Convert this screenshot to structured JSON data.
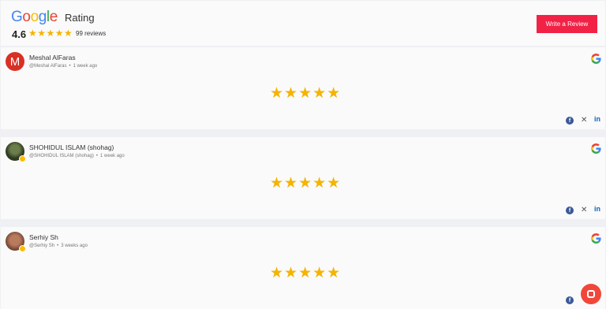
{
  "header": {
    "logo_letters": [
      "G",
      "o",
      "o",
      "g",
      "l",
      "e"
    ],
    "rating_title": "Rating",
    "score": "4.6",
    "stars": "★★★★★",
    "review_count": "99 reviews",
    "write_review_label": "Write a Review"
  },
  "reviews": [
    {
      "name": "Meshal AlFaras",
      "handle": "@Meshal AlFaras",
      "time": "1 week ago",
      "avatar_letter": "M",
      "stars": "★★★★★"
    },
    {
      "name": "SHOHIDUL ISLAM (shohag)",
      "handle": "@SHOHIDUL ISLAM (shohag)",
      "time": "1 week ago",
      "avatar_letter": "",
      "stars": "★★★★★"
    },
    {
      "name": "Serhiy Sh",
      "handle": "@Serhiy Sh",
      "time": "3 weeks ago",
      "avatar_letter": "",
      "stars": "★★★★★"
    }
  ],
  "share": {
    "facebook": "f",
    "x": "𝕏",
    "linkedin": "in"
  },
  "colors": {
    "accent": "#f12246",
    "star": "#f4b400",
    "background": "#eef0f3",
    "card": "#fafafa",
    "chat": "#f0473a"
  },
  "icons": [
    "google-logo-icon",
    "star-icon",
    "facebook-icon",
    "x-icon",
    "linkedin-icon",
    "chat-icon"
  ]
}
